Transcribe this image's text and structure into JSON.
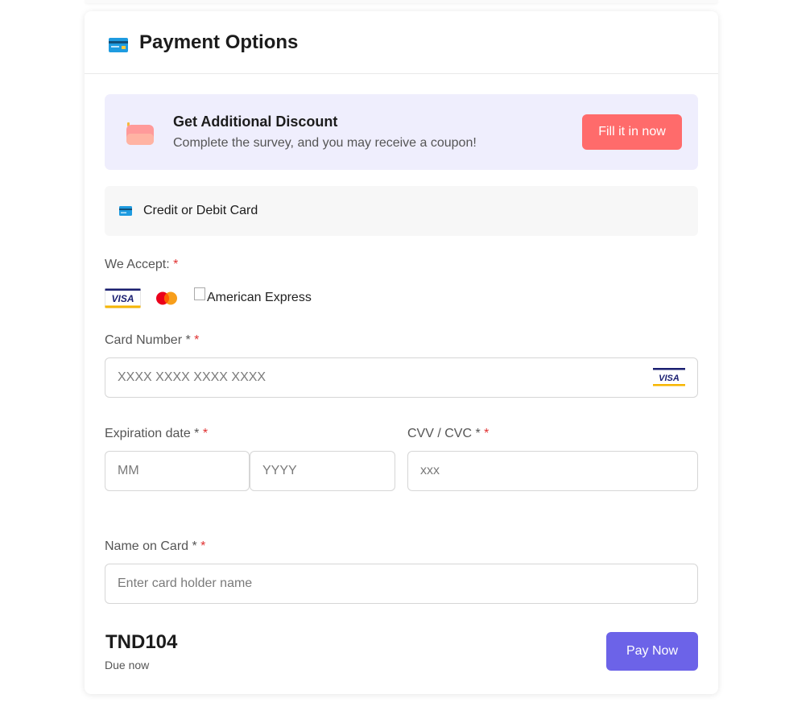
{
  "header": {
    "title": "Payment Options",
    "icon": "credit-card-icon"
  },
  "discount": {
    "title": "Get Additional Discount",
    "subtitle": "Complete the survey, and you may receive a coupon!",
    "button_label": "Fill it in now",
    "icon": "wallet-icon"
  },
  "method": {
    "label": "Credit or Debit Card",
    "icon": "credit-card-icon"
  },
  "accept": {
    "label": "We Accept:",
    "required_mark": "*",
    "brands": {
      "visa": "VISA",
      "amex_alt": "American Express"
    }
  },
  "card_number": {
    "label": "Card Number *",
    "required_mark": "*",
    "placeholder": "XXXX XXXX XXXX XXXX",
    "brand_badge": "VISA"
  },
  "expiration": {
    "label": "Expiration date *",
    "required_mark": "*",
    "month_placeholder": "MM",
    "year_placeholder": "YYYY"
  },
  "cvv": {
    "label": "CVV / CVC *",
    "required_mark": "*",
    "placeholder": "xxx"
  },
  "name": {
    "label": "Name on Card *",
    "required_mark": "*",
    "placeholder": "Enter card holder name"
  },
  "footer": {
    "amount": "TND104",
    "due_label": "Due now",
    "pay_label": "Pay Now"
  },
  "colors": {
    "accent": "#6c63e8",
    "coral": "#ff6b6b",
    "banner_bg": "#efeefd",
    "required": "#e03131"
  }
}
